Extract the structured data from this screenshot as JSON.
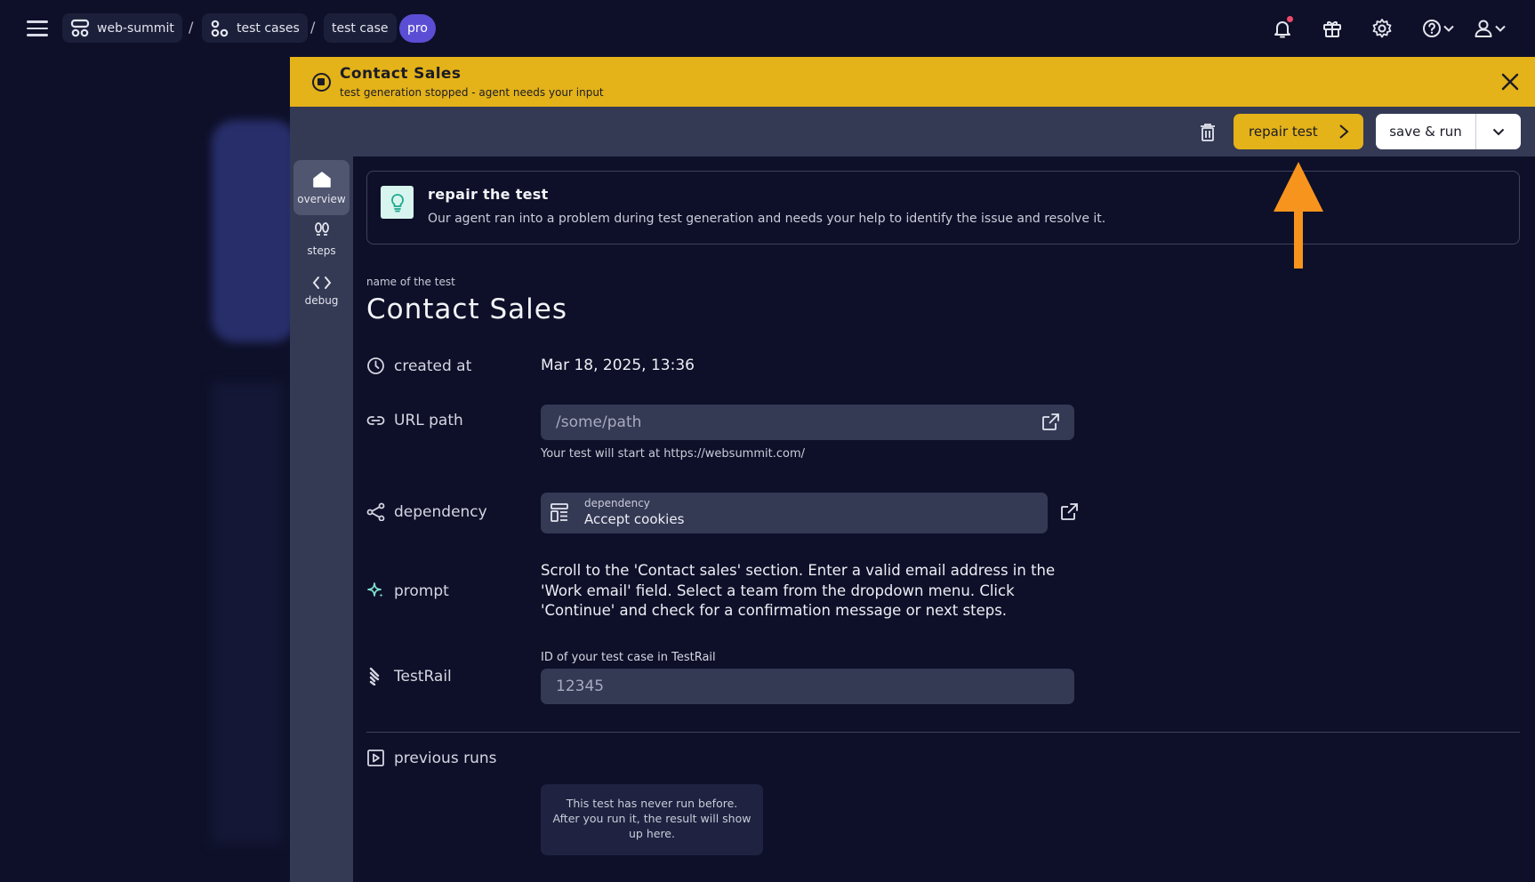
{
  "breadcrumb": {
    "project": "web-summit",
    "section": "test cases",
    "page": "test case",
    "separator": "/",
    "badge": "pro"
  },
  "topbar_icons": [
    "menu-icon",
    "bell-icon",
    "gift-icon",
    "gear-icon",
    "help-icon",
    "user-icon"
  ],
  "banner": {
    "title": "Contact Sales",
    "subtitle": "test generation stopped - agent needs your input",
    "color": "#e4b219"
  },
  "actions": {
    "repair_label": "repair test",
    "save_run_label": "save & run"
  },
  "sidenav": [
    {
      "label": "overview",
      "icon": "home-icon",
      "active": true
    },
    {
      "label": "steps",
      "icon": "footsteps-icon",
      "active": false
    },
    {
      "label": "debug",
      "icon": "code-icon",
      "active": false
    }
  ],
  "repair_card": {
    "title": "repair the test",
    "description": "Our agent ran into a problem during test generation and needs your help to identify the issue and resolve it."
  },
  "test": {
    "name_label": "name of the test",
    "name": "Contact Sales",
    "created_label": "created at",
    "created_value": "Mar 18, 2025, 13:36",
    "url_label": "URL path",
    "url_placeholder": "/some/path",
    "url_hint": "Your test will start at https://websummit.com/",
    "dependency_label": "dependency",
    "dependency_small": "dependency",
    "dependency_value": "Accept cookies",
    "prompt_label": "prompt",
    "prompt_text": "Scroll to the 'Contact sales' section. Enter a valid email address in the 'Work email' field. Select a team from the dropdown menu. Click 'Continue' and check for a confirmation message or next steps.",
    "testrail_label": "TestRail",
    "testrail_field_label": "ID of your test case in TestRail",
    "testrail_placeholder": "12345",
    "previous_runs_label": "previous runs",
    "previous_runs_empty": "This test has never run before. After you run it, the result will show up here."
  },
  "colors": {
    "background": "#0e1029",
    "panel": "#343954",
    "accent_yellow": "#e4b219",
    "pro_badge": "#5b4ed4",
    "annotation_arrow": "#f7941d"
  }
}
